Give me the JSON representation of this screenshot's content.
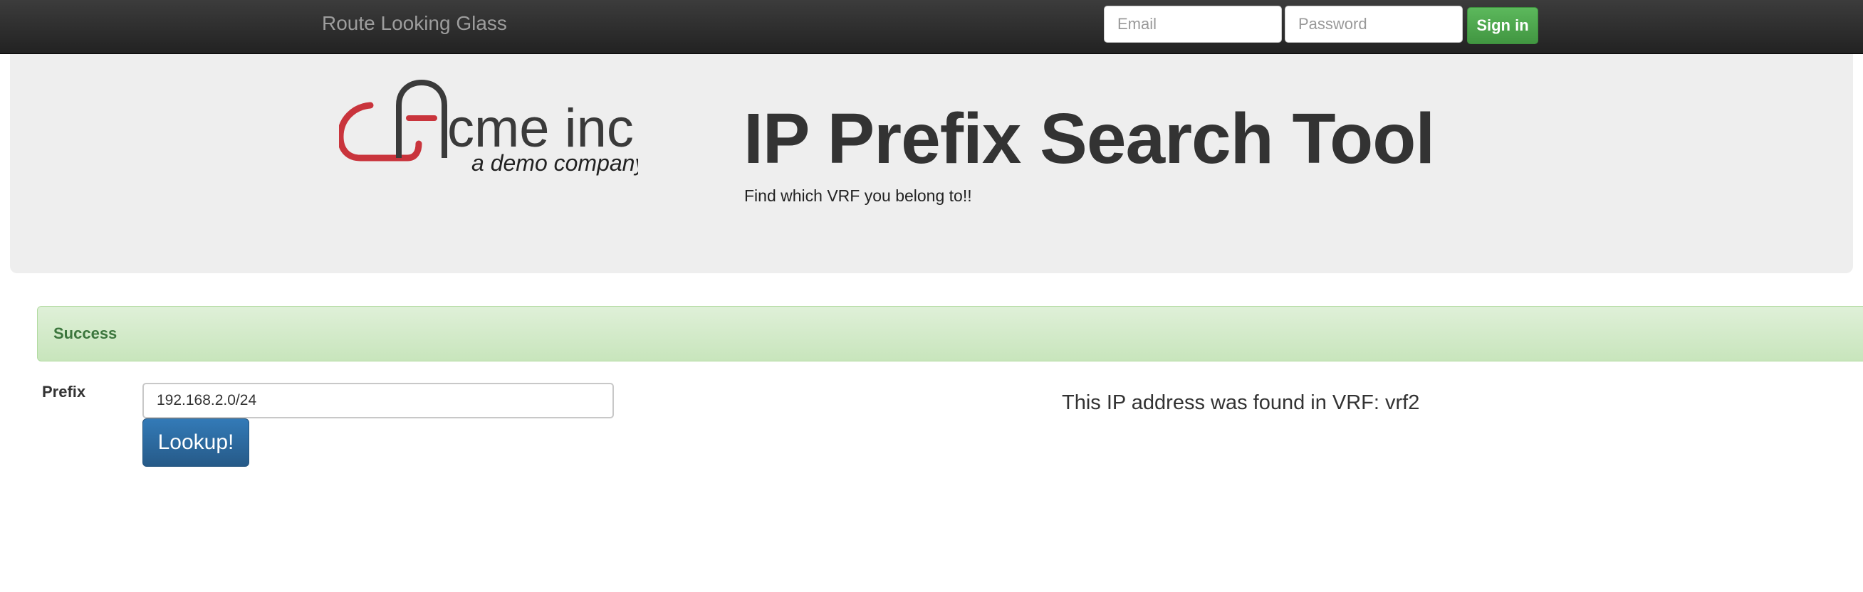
{
  "navbar": {
    "brand": "Route Looking Glass",
    "email_placeholder": "Email",
    "password_placeholder": "Password",
    "signin_label": "Sign in"
  },
  "header": {
    "logo_text": "cme inc.",
    "logo_tagline": "a demo company",
    "title": "IP Prefix Search Tool",
    "subtitle": "Find which VRF you belong to!!"
  },
  "alert": {
    "text": "Success"
  },
  "form": {
    "prefix_label": "Prefix",
    "prefix_value": "192.168.2.0/24",
    "lookup_label": "Lookup!"
  },
  "result": {
    "text": "This IP address was found in VRF: vrf2"
  },
  "colors": {
    "navbar_bg": "#222222",
    "jumbotron_bg": "#eeeeee",
    "success_bg": "#dff0d8",
    "success_text": "#3c763d",
    "primary_btn": "#337ab7",
    "signin_btn": "#5cb85c",
    "logo_red": "#c9343c"
  },
  "icons": {
    "logo": "acme-logo-icon"
  }
}
